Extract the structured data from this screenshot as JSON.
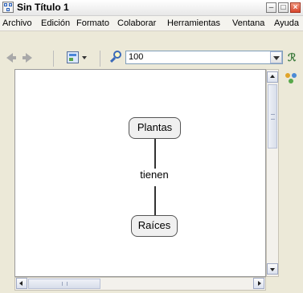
{
  "window": {
    "title": "Sin Título 1"
  },
  "menu": {
    "items": [
      "Archivo",
      "Edición",
      "Formato",
      "Colaborar",
      "Herramientas",
      "Ventana",
      "Ayuda"
    ]
  },
  "toolbar": {
    "zoom_value": "100"
  },
  "map": {
    "concepts": [
      "Plantas",
      "Raíces"
    ],
    "linking_phrase": "tienen"
  },
  "icons": {
    "app": "concept-map-icon",
    "back": "back-arrow-icon",
    "forward": "forward-arrow-icon",
    "view": "view-icon",
    "zoom": "zoom-icon",
    "styles": "styles-icon",
    "collaborate": "collaboration-icon"
  },
  "colors": {
    "background": "#ece9d8",
    "canvas": "#ffffff",
    "concept_fill": "#f0f0f0"
  }
}
